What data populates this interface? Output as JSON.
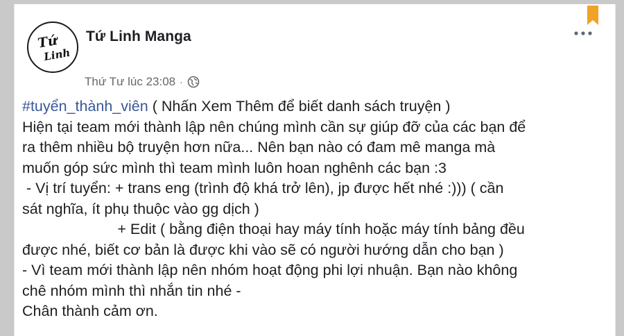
{
  "page": {
    "name": "Tứ Linh Manga",
    "avatar_text_top": "Tứ",
    "avatar_text_bottom": "Linh"
  },
  "meta": {
    "timestamp": "Thứ Tư lúc 23:08",
    "separator": "·",
    "privacy_icon": "globe-icon"
  },
  "actions": {
    "more_icon": "more-options-icon",
    "bookmark_icon": "bookmark-icon",
    "bookmark_color": "#f0a326"
  },
  "post": {
    "hashtag": "#tuyển_thành_viên",
    "line1_rest": " ( Nhấn Xem Thêm để biết danh sách truyện )",
    "lines": [
      "Hiện tại team mới thành lập nên chúng mình cần sự giúp đỡ của các bạn để",
      "ra thêm nhiều bộ truyện hơn nữa... Nên bạn nào có đam mê manga mà",
      "muốn góp sức mình thì team mình luôn hoan nghênh các bạn :3",
      " - Vị trí tuyển: + trans eng (trình độ khá trở lên), jp được hết nhé :))) ( cần",
      "sát nghĩa, ít phụ thuộc vào gg dịch )",
      "                       + Edit ( bằng điện thoại hay máy tính hoặc máy tính bảng đều",
      "được nhé, biết cơ bản là được khi vào sẽ có người hướng dẫn cho bạn )",
      "- Vì team mới thành lập nên nhóm hoạt động phi lợi nhuận. Bạn nào không",
      "chê nhóm mình thì nhắn tin nhé -",
      "Chân thành cảm ơn."
    ]
  },
  "colors": {
    "hashtag": "#385898",
    "text": "#1c1e21",
    "meta": "#65676b"
  }
}
